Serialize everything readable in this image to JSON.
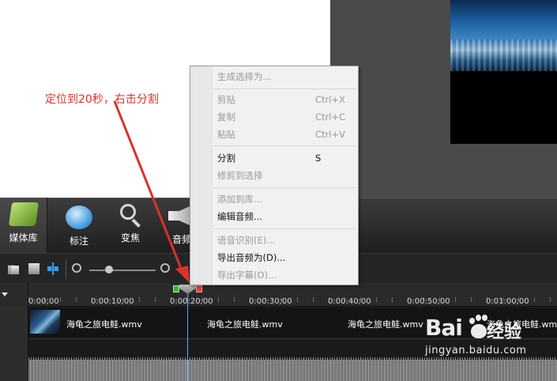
{
  "annotation": {
    "text": "定位到20秒，右击分割"
  },
  "tool_tabs": [
    {
      "label": "媒体库",
      "icon": "media-library-icon"
    },
    {
      "label": "标注",
      "icon": "callout-icon"
    },
    {
      "label": "变焦",
      "icon": "zoom-icon"
    },
    {
      "label": "音频",
      "icon": "audio-icon"
    }
  ],
  "context_menu": {
    "items": [
      {
        "label": "生成选择为...",
        "shortcut": "",
        "enabled": false
      },
      {
        "label": "剪贴",
        "shortcut": "Ctrl+X",
        "enabled": false
      },
      {
        "label": "复制",
        "shortcut": "Ctrl+C",
        "enabled": false
      },
      {
        "label": "粘贴",
        "shortcut": "Ctrl+V",
        "enabled": false
      },
      {
        "label": "分割",
        "shortcut": "S",
        "enabled": true
      },
      {
        "label": "修剪到选择",
        "shortcut": "",
        "enabled": false
      },
      {
        "label": "添加到库...",
        "shortcut": "",
        "enabled": false
      },
      {
        "label": "编辑音频...",
        "shortcut": "",
        "enabled": true
      },
      {
        "label": "语音识别(E)...",
        "shortcut": "",
        "enabled": false
      },
      {
        "label": "导出音频为(D)...",
        "shortcut": "",
        "enabled": true
      },
      {
        "label": "导出字幕(O)...",
        "shortcut": "",
        "enabled": false
      }
    ]
  },
  "timeline": {
    "ruler_labels": [
      "0:00;00",
      "0:00:10;00",
      "0:00:20;00",
      "0:00:30;00",
      "0:00:40;00",
      "0:00:50;00",
      "0:01:00;00"
    ],
    "clip_name": "海龟之旅电鲑.wmv",
    "playhead_time": "0:00:20;00"
  },
  "watermark": {
    "brand": "Bai",
    "brand_suffix": "经验",
    "url": "jingyan.baidu.com"
  },
  "colors": {
    "annotation_red": "#d8322c",
    "playhead_blue": "#5aa7ff"
  }
}
